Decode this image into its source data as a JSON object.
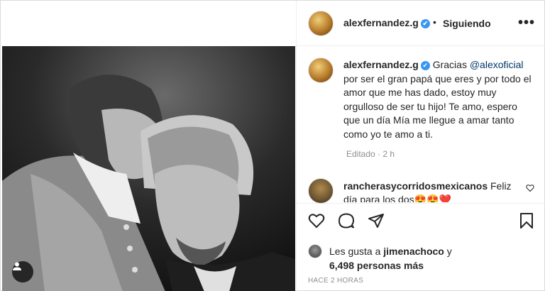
{
  "post": {
    "username": "alexfernandez.g",
    "separator": "•",
    "follow_label": "Siguiendo",
    "more_label": "•••",
    "verified_mark": "✔"
  },
  "caption": {
    "username": "alexfernandez.g",
    "text_before": " Gracias ",
    "mention": "@alexoficial",
    "text_after": " por ser el gran papá que eres y por todo el amor que me has dado, estoy muy orgulloso de ser tu hijo! Te amo, espero que un día Mía me llegue a amar tanto como yo te amo a ti.",
    "edited": "Editado · 2 h"
  },
  "comment": {
    "username": "rancherasycorridosmexicanos",
    "text": " Feliz día para los dos😍😍❤️"
  },
  "likes": {
    "prefix": "Les gusta a ",
    "user": "jimenachoco",
    "conj": " y",
    "count": "6,498 personas más"
  },
  "timestamp": "HACE 2 HORAS",
  "icons": [
    "heart-icon",
    "comment-icon",
    "share-icon",
    "bookmark-icon",
    "user-tag-icon",
    "more-icon"
  ],
  "colors": {
    "verified": "#3897f0",
    "mention": "#00376b",
    "muted": "#8e8e8e"
  }
}
